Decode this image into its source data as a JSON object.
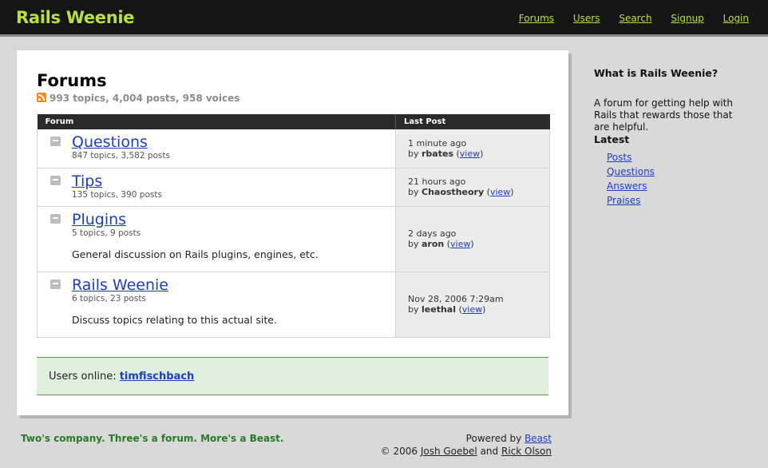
{
  "site": {
    "title": "Rails Weenie"
  },
  "nav": {
    "forums": "Forums",
    "users": "Users",
    "search": "Search",
    "signup": "Signup",
    "login": "Login"
  },
  "main": {
    "title": "Forums",
    "stats": "993 topics, 4,004 posts, 958 voices",
    "table": {
      "headers": {
        "forum": "Forum",
        "last_post": "Last Post"
      },
      "rows": [
        {
          "name": "Questions",
          "counts": "847 topics, 3,582 posts",
          "description": "",
          "time": "1 minute ago",
          "by_prefix": "by",
          "user": "rbates",
          "view": "view"
        },
        {
          "name": "Tips",
          "counts": "135 topics, 390 posts",
          "description": "",
          "time": "21 hours ago",
          "by_prefix": "by",
          "user": "Chaostheory",
          "view": "view"
        },
        {
          "name": "Plugins",
          "counts": "5 topics, 9 posts",
          "description": "General discussion on Rails plugins, engines, etc.",
          "time": "2 days ago",
          "by_prefix": "by",
          "user": "aron",
          "view": "view"
        },
        {
          "name": "Rails Weenie",
          "counts": "6 topics, 23 posts",
          "description": "Discuss topics relating to this actual site.",
          "time": "Nov 28, 2006 7:29am",
          "by_prefix": "by",
          "user": "leethal",
          "view": "view"
        }
      ]
    },
    "online": {
      "label": "Users online:",
      "user": "timfischbach"
    }
  },
  "sidebar": {
    "about_title": "What is Rails Weenie?",
    "about_text": "A forum for getting help with Rails that rewards those that are helpful.",
    "latest_title": "Latest",
    "latest_links": [
      "Posts",
      "Questions",
      "Answers",
      "Praises"
    ]
  },
  "footer": {
    "tagline": "Two's company. Three's a forum. More's a Beast.",
    "powered_label": "Powered by",
    "powered_link": "Beast",
    "copyright": "© 2006",
    "author1": "Josh Goebel",
    "and": "and",
    "author2": "Rick Olson"
  },
  "colors": {
    "header_bg": "#151515",
    "accent_green": "#b8e336",
    "link_blue": "#1d3fbf",
    "online_bg": "#dff0dc",
    "tagline_green": "#267a26"
  },
  "icons": {
    "feed": "rss-feed-icon",
    "forum": "speech-bubble-icon"
  }
}
